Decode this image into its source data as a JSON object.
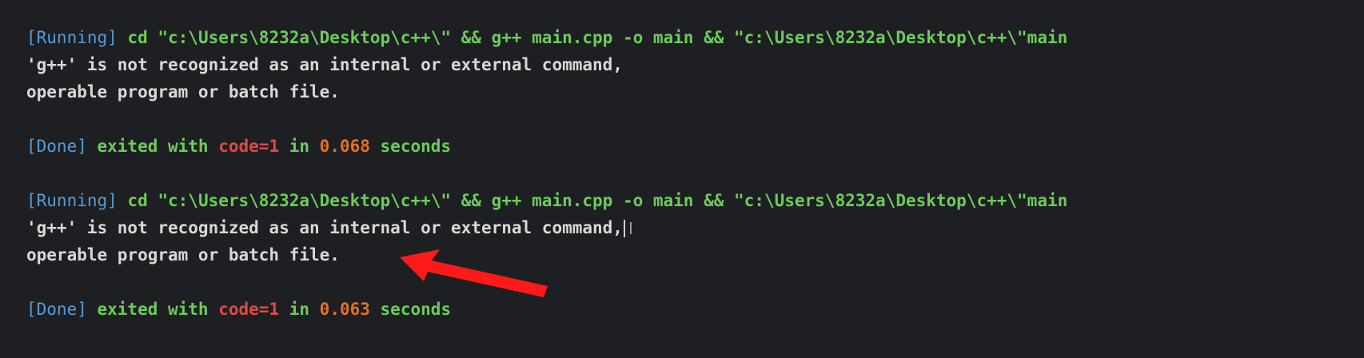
{
  "runs": [
    {
      "running_tag": "[Running]",
      "command": " cd \"c:\\Users\\8232a\\Desktop\\c++\\\" && g++ main.cpp -o main && \"c:\\Users\\8232a\\Desktop\\c++\\\"main",
      "error_line_1": "'g++' is not recognized as an internal or external command,",
      "error_line_2": "operable program or batch file.",
      "done_tag": "[Done]",
      "exited_text": " exited with ",
      "code_text": "code=1",
      "in_text": " in ",
      "time": "0.068",
      "seconds_text": " seconds"
    },
    {
      "running_tag": "[Running]",
      "command": " cd \"c:\\Users\\8232a\\Desktop\\c++\\\" && g++ main.cpp -o main && \"c:\\Users\\8232a\\Desktop\\c++\\\"main",
      "error_line_1": "'g++' is not recognized as an internal or external command,",
      "error_line_2": "operable program or batch file.",
      "done_tag": "[Done]",
      "exited_text": " exited with ",
      "code_text": "code=1",
      "in_text": " in ",
      "time": "0.063",
      "seconds_text": " seconds"
    }
  ],
  "colors": {
    "background": "#1e1f22",
    "tag": "#569cd6",
    "command": "#6ccc5a",
    "error_text": "#d8d8d8",
    "exit_code": "#e04848",
    "time": "#e0702a",
    "annotation_arrow": "#ff1a1a"
  },
  "icons": {
    "cursor": "text-ibeam-cursor-icon",
    "annotation": "red-arrow-icon"
  }
}
